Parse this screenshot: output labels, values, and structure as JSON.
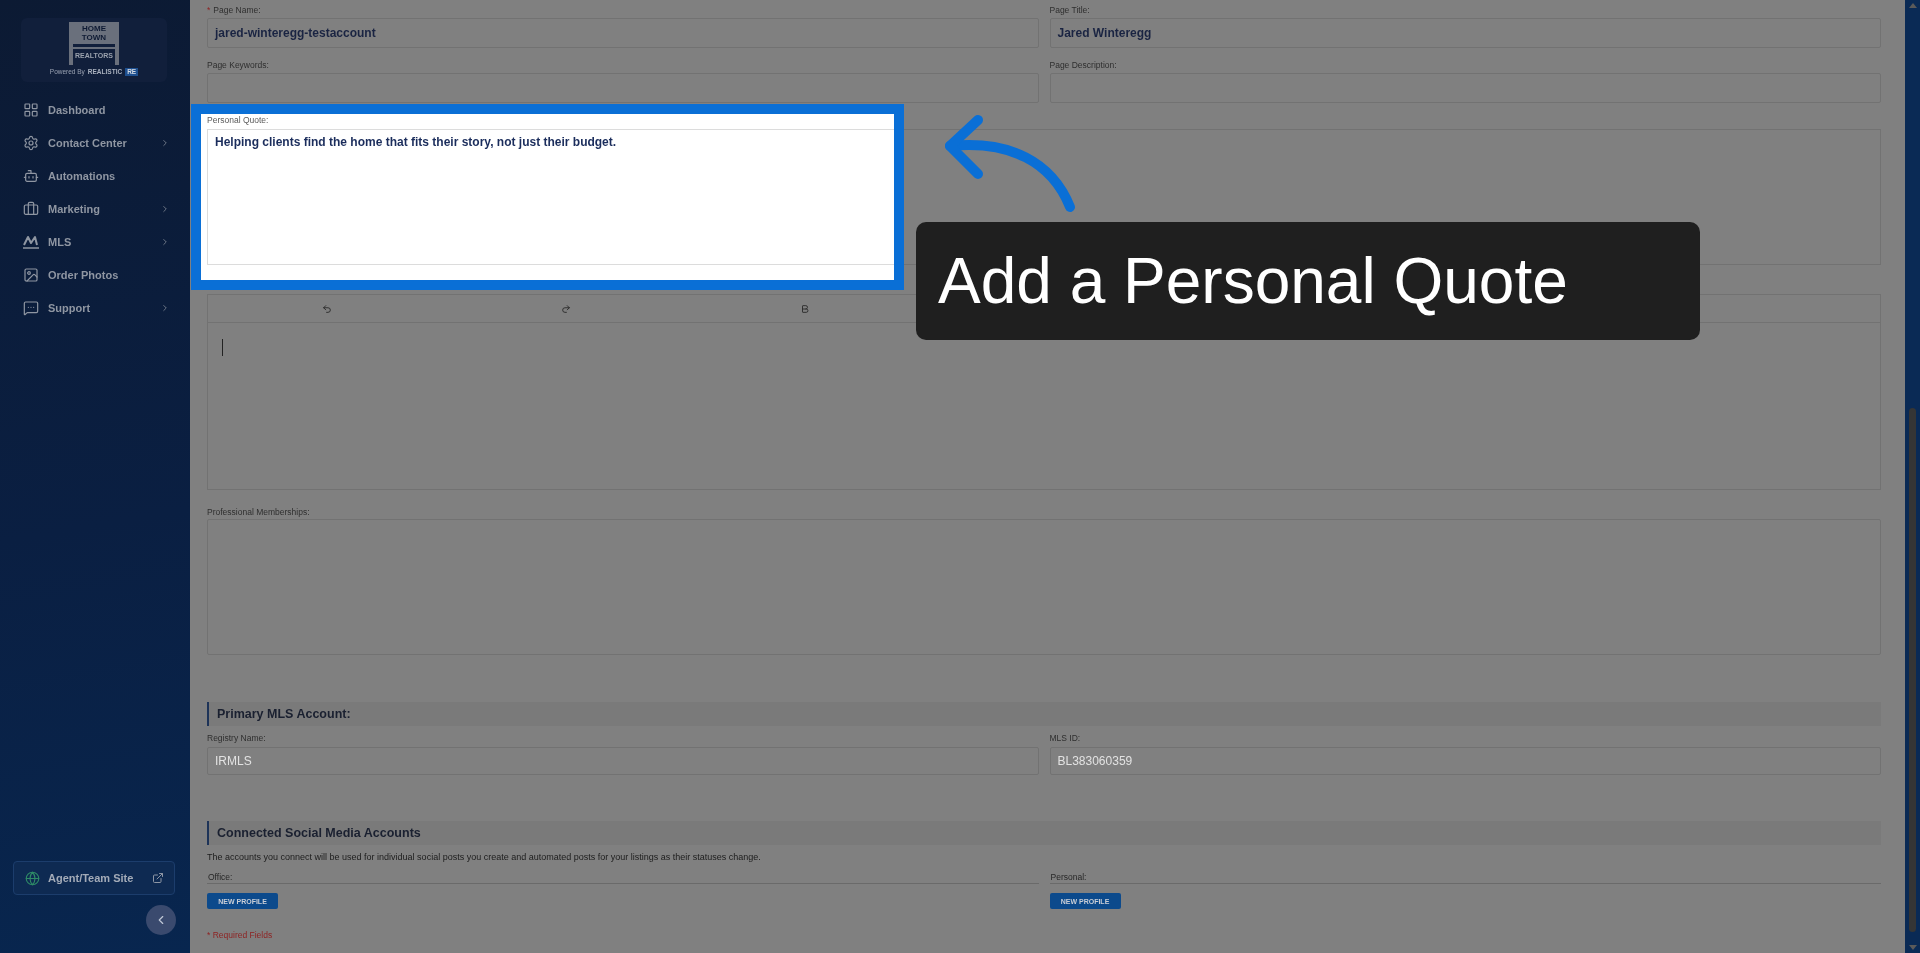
{
  "sidebar": {
    "logo": {
      "title": "HOME TOWN",
      "subtitle": "REALTORS",
      "powered_by": "Powered By",
      "brand": "REALISTIC",
      "brand_badge": "RE"
    },
    "items": [
      {
        "label": "Dashboard",
        "submenu": false,
        "selected": false
      },
      {
        "label": "Contact Center",
        "submenu": true,
        "selected": false
      },
      {
        "label": "Automations",
        "submenu": false,
        "selected": false
      },
      {
        "label": "Marketing",
        "submenu": true,
        "selected": false
      },
      {
        "label": "MLS",
        "submenu": true,
        "selected": false
      },
      {
        "label": "Order Photos",
        "submenu": false,
        "selected": false
      },
      {
        "label": "Support",
        "submenu": true,
        "selected": false
      }
    ],
    "site_link": {
      "label": "Agent/Team Site"
    }
  },
  "page_settings": {
    "rows": [
      [
        {
          "label": "Page Name:",
          "required_mark": "*",
          "value": "jared-winteregg-testaccount"
        },
        {
          "label": "Page Title:",
          "value": "Jared Winteregg"
        }
      ],
      [
        {
          "label": "Page Keywords:"
        },
        {
          "label": "Page Description:"
        }
      ]
    ]
  },
  "personal_quote": {
    "label": "Personal Quote:",
    "value": "Helping clients find the home that fits their story, not just their budget."
  },
  "professional_memberships": {
    "label": "Professional Memberships:"
  },
  "primary_mls": {
    "title": "Primary MLS Account:",
    "fields": [
      {
        "label": "Registry Name:",
        "value": "IRMLS",
        "disabled": true
      },
      {
        "label": "MLS ID:",
        "value": "BL383060359",
        "disabled": true
      }
    ]
  },
  "social_media": {
    "title": "Connected Social Media Accounts",
    "description": "The accounts you connect will be used for individual social posts you create and automated posts for your listings as their statuses change.",
    "accounts": [
      {
        "label": "Office:",
        "button": "NEW PROFILE"
      },
      {
        "label": "Personal:",
        "button": "NEW PROFILE"
      }
    ]
  },
  "required_note": "* Required Fields",
  "tutorial": {
    "callout": "Add a Personal Quote"
  }
}
